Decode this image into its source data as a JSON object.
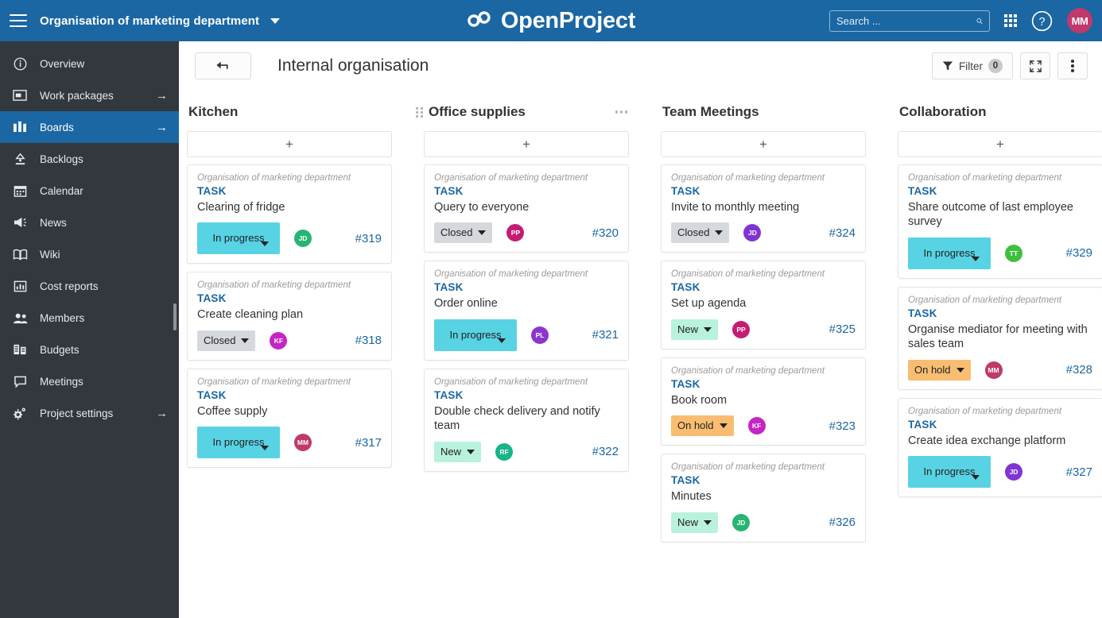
{
  "header": {
    "menu_icon": "hamburger-icon",
    "project_name": "Organisation of marketing department",
    "logo_text": "OpenProject",
    "search_placeholder": "Search ...",
    "search_value": "",
    "search_icon": "search-icon",
    "modules_icon": "grid-apps-icon",
    "help_icon": "help-circle-icon",
    "avatar_initials": "MM",
    "avatar_color": "#C0396B",
    "background_color": "#1A67A3"
  },
  "sidebar": {
    "background_color": "#32383D",
    "active_color": "#1A67A3",
    "items": [
      {
        "label": "Overview",
        "icon": "info-circle-icon",
        "arrow": "",
        "active": false
      },
      {
        "label": "Work packages",
        "icon": "work-packages-icon",
        "arrow": "→",
        "active": false
      },
      {
        "label": "Boards",
        "icon": "boards-icon",
        "arrow": "→",
        "active": true
      },
      {
        "label": "Backlogs",
        "icon": "backlogs-icon",
        "arrow": "",
        "active": false
      },
      {
        "label": "Calendar",
        "icon": "calendar-icon",
        "arrow": "",
        "active": false
      },
      {
        "label": "News",
        "icon": "megaphone-icon",
        "arrow": "",
        "active": false
      },
      {
        "label": "Wiki",
        "icon": "book-icon",
        "arrow": "",
        "active": false
      },
      {
        "label": "Cost reports",
        "icon": "chart-report-icon",
        "arrow": "",
        "active": false
      },
      {
        "label": "Members",
        "icon": "people-icon",
        "arrow": "",
        "active": false
      },
      {
        "label": "Budgets",
        "icon": "budgets-icon",
        "arrow": "",
        "active": false
      },
      {
        "label": "Meetings",
        "icon": "speech-bubble-icon",
        "arrow": "",
        "active": false
      },
      {
        "label": "Project settings",
        "icon": "gears-icon",
        "arrow": "→",
        "active": false
      }
    ]
  },
  "toolbar": {
    "back_icon": "back-arrow-icon",
    "title": "Internal organisation",
    "filter_label": "Filter",
    "filter_count": "0",
    "filter_icon": "funnel-icon",
    "fullscreen_icon": "fullscreen-expand-icon",
    "more_icon": "vertical-dots-icon"
  },
  "board": {
    "add_label": "+",
    "status_colors": {
      "New": "#B9F2DC",
      "In progress": "#58D3E4",
      "Closed": "#D5D9DD",
      "On hold": "#F9BD72"
    },
    "columns": [
      {
        "title": "Kitchen",
        "has_grip": false,
        "has_menu": false,
        "cards": [
          {
            "project": "Organisation of marketing department",
            "type": "TASK",
            "subject": "Clearing of fridge",
            "status": "In progress",
            "avatar": "JD",
            "avatar_color": "#29B473",
            "id": "#319"
          },
          {
            "project": "Organisation of marketing department",
            "type": "TASK",
            "subject": "Create cleaning plan",
            "status": "Closed",
            "avatar": "KF",
            "avatar_color": "#C425C4",
            "id": "#318"
          },
          {
            "project": "Organisation of marketing department",
            "type": "TASK",
            "subject": "Coffee supply",
            "status": "In progress",
            "avatar": "MM",
            "avatar_color": "#C0396B",
            "id": "#317"
          }
        ]
      },
      {
        "title": "Office supplies",
        "has_grip": true,
        "has_menu": true,
        "cards": [
          {
            "project": "Organisation of marketing department",
            "type": "TASK",
            "subject": "Query to everyone",
            "status": "Closed",
            "avatar": "PP",
            "avatar_color": "#C41C74",
            "id": "#320"
          },
          {
            "project": "Organisation of marketing department",
            "type": "TASK",
            "subject": "Order online",
            "status": "In progress",
            "avatar": "PL",
            "avatar_color": "#8E35CE",
            "id": "#321"
          },
          {
            "project": "Organisation of marketing department",
            "type": "TASK",
            "subject": "Double check delivery and notify team",
            "status": "New",
            "avatar": "RF",
            "avatar_color": "#16B587",
            "id": "#322"
          }
        ]
      },
      {
        "title": "Team Meetings",
        "has_grip": false,
        "has_menu": false,
        "cards": [
          {
            "project": "Organisation of marketing department",
            "type": "TASK",
            "subject": "Invite to monthly meeting",
            "status": "Closed",
            "avatar": "JD",
            "avatar_color": "#8134D4",
            "id": "#324"
          },
          {
            "project": "Organisation of marketing department",
            "type": "TASK",
            "subject": "Set up agenda",
            "status": "New",
            "avatar": "PP",
            "avatar_color": "#C41C74",
            "id": "#325"
          },
          {
            "project": "Organisation of marketing department",
            "type": "TASK",
            "subject": "Book room",
            "status": "On hold",
            "avatar": "KF",
            "avatar_color": "#C425C4",
            "id": "#323"
          },
          {
            "project": "Organisation of marketing department",
            "type": "TASK",
            "subject": "Minutes",
            "status": "New",
            "avatar": "JD",
            "avatar_color": "#29B473",
            "id": "#326"
          }
        ]
      },
      {
        "title": "Collaboration",
        "has_grip": false,
        "has_menu": false,
        "cards": [
          {
            "project": "Organisation of marketing department",
            "type": "TASK",
            "subject": "Share outcome of last employee survey",
            "status": "In progress",
            "avatar": "TT",
            "avatar_color": "#3FBF3F",
            "id": "#329"
          },
          {
            "project": "Organisation of marketing department",
            "type": "TASK",
            "subject": "Organise mediator for meeting with sales team",
            "status": "On hold",
            "avatar": "MM",
            "avatar_color": "#C0396B",
            "id": "#328"
          },
          {
            "project": "Organisation of marketing department",
            "type": "TASK",
            "subject": "Create idea exchange platform",
            "status": "In progress",
            "avatar": "JD",
            "avatar_color": "#8134D4",
            "id": "#327"
          }
        ]
      }
    ]
  }
}
